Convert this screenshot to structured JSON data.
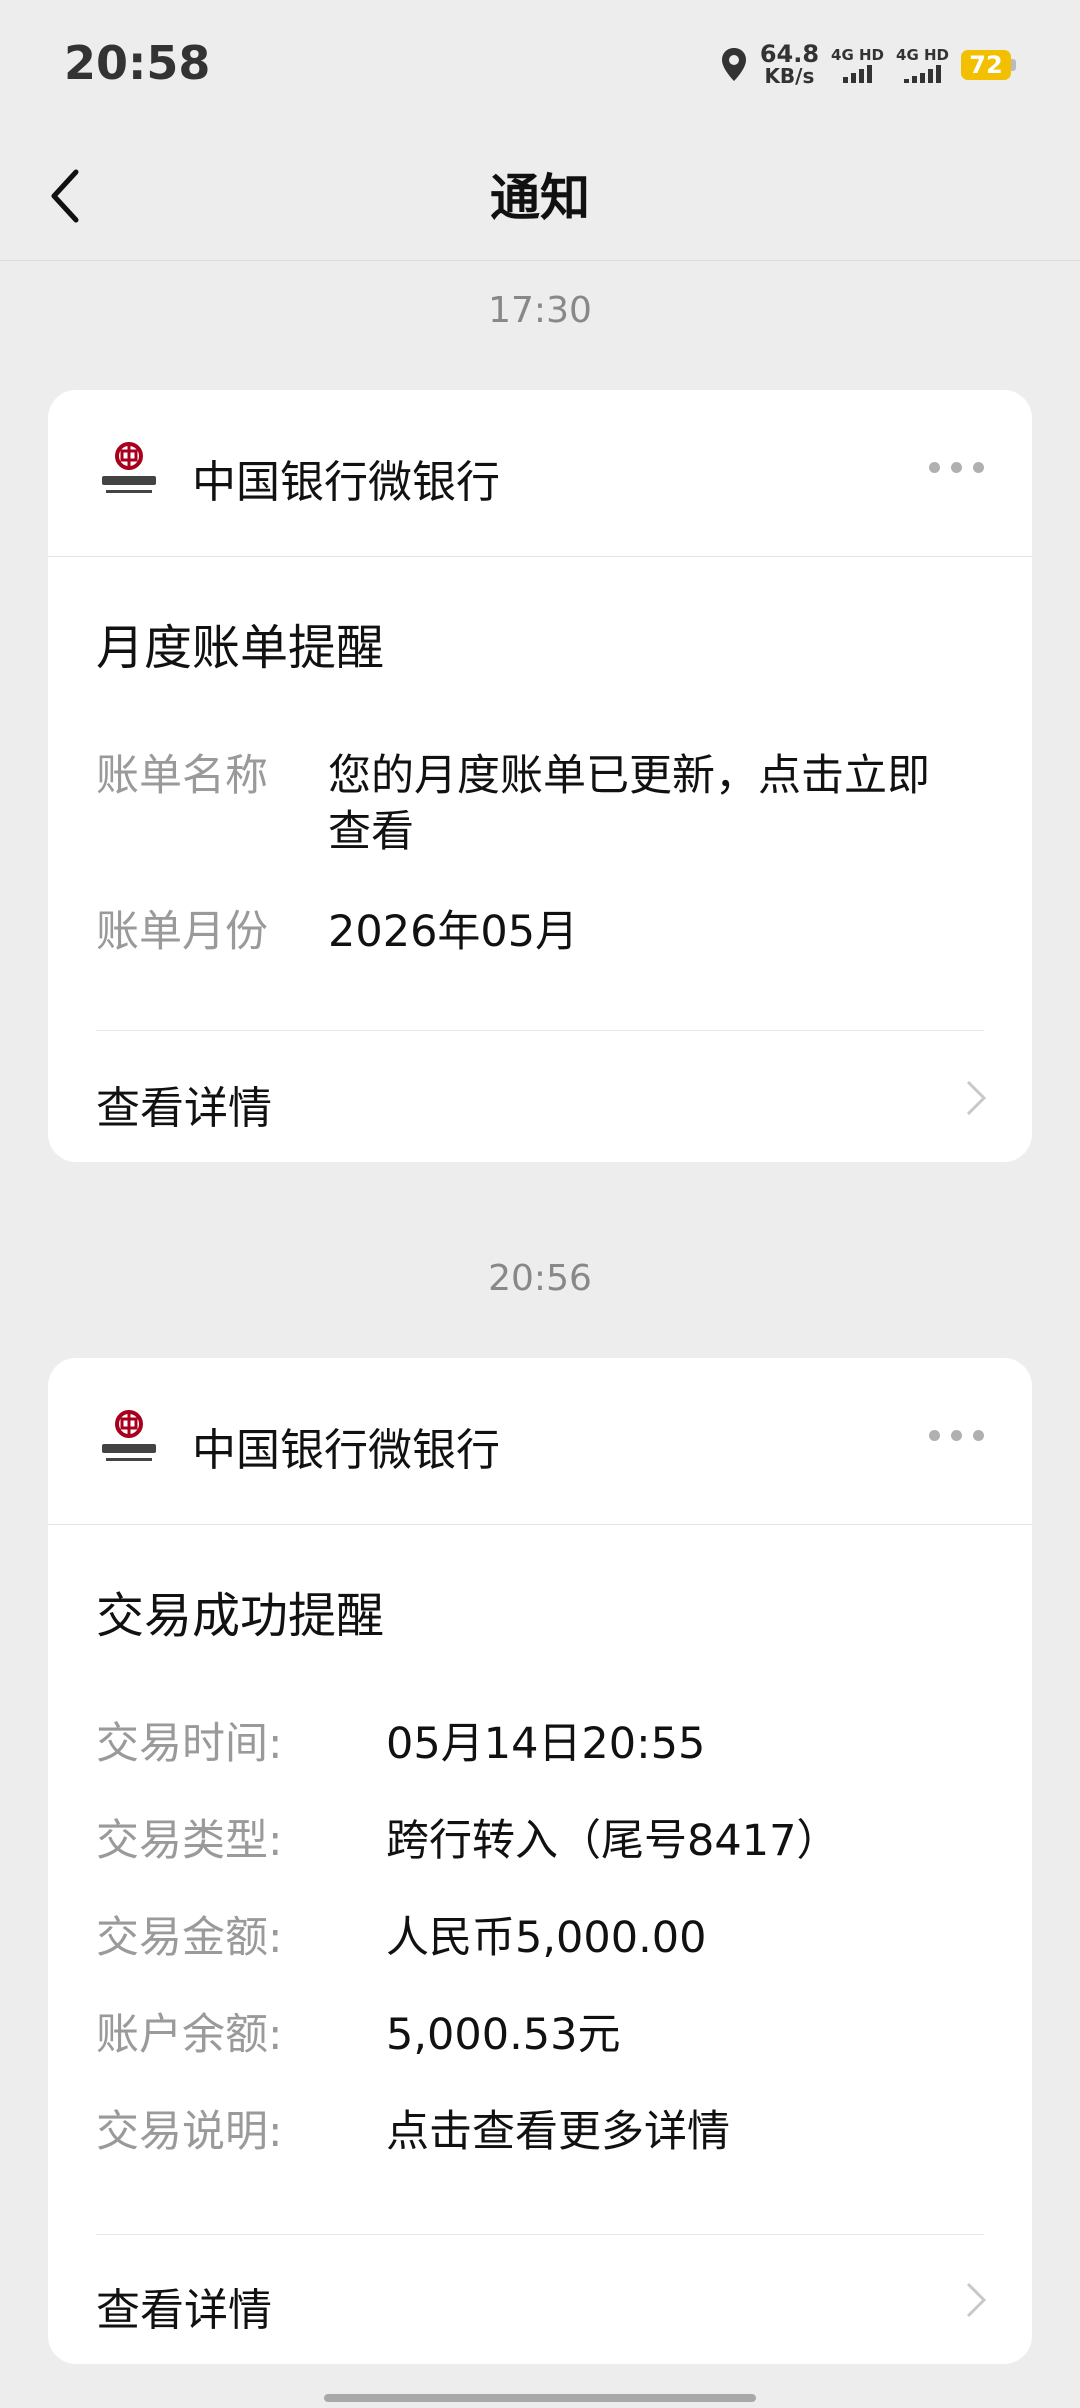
{
  "status_bar": {
    "time": "20:58",
    "net_speed_value": "64.8",
    "net_speed_unit": "KB/s",
    "sim1_label": "4G HD",
    "sim2_label": "4G HD",
    "battery": "72",
    "icons": [
      "location-icon",
      "signal-icon",
      "battery-icon"
    ]
  },
  "nav": {
    "title": "通知",
    "back_icon": "chevron-left-icon"
  },
  "notifications": [
    {
      "time": "17:30",
      "sender": "中国银行微银行",
      "title": "月度账单提醒",
      "fields": [
        {
          "label": "账单名称",
          "value_line1": "您的月度账单已更新，点击立即",
          "value_line2": "查看"
        },
        {
          "label": "账单月份",
          "value_line1": "2026年05月"
        }
      ],
      "action": "查看详情"
    },
    {
      "time": "20:56",
      "sender": "中国银行微银行",
      "title": "交易成功提醒",
      "fields": [
        {
          "label": "交易时间:",
          "value_line1": "05月14日20:55"
        },
        {
          "label": "交易类型:",
          "value_line1": "跨行转入（尾号8417）"
        },
        {
          "label": "交易金额:",
          "value_line1": "人民币5,000.00"
        },
        {
          "label": "账户余额:",
          "value_line1": "5,000.53元"
        },
        {
          "label": "交易说明:",
          "value_line1": "点击查看更多详情"
        }
      ],
      "action": "查看详情"
    }
  ],
  "colors": {
    "background": "#ededed",
    "card": "#ffffff",
    "label_gray": "#9a9a9a",
    "battery": "#f2c000",
    "logo_red": "#a8001c"
  }
}
